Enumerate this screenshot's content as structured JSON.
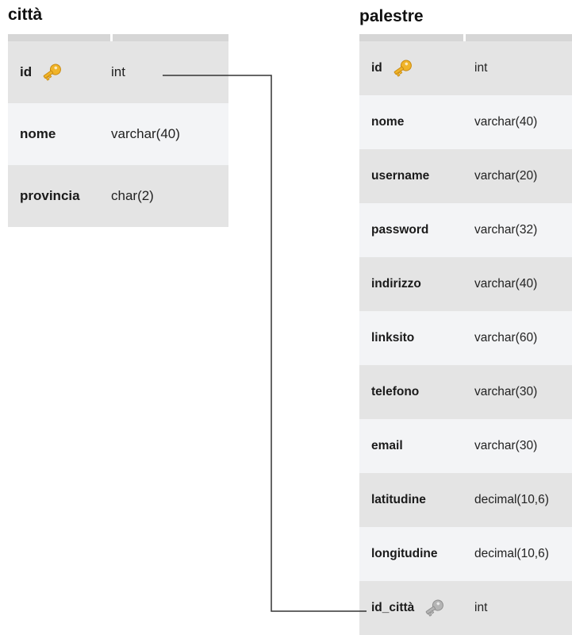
{
  "tables": [
    {
      "title": "città",
      "columns": [
        {
          "name": "id",
          "type": "int",
          "key": "primary"
        },
        {
          "name": "nome",
          "type": "varchar(40)",
          "key": ""
        },
        {
          "name": "provincia",
          "type": "char(2)",
          "key": ""
        }
      ]
    },
    {
      "title": "palestre",
      "columns": [
        {
          "name": "id",
          "type": "int",
          "key": "primary"
        },
        {
          "name": "nome",
          "type": "varchar(40)",
          "key": ""
        },
        {
          "name": "username",
          "type": "varchar(20)",
          "key": ""
        },
        {
          "name": "password",
          "type": "varchar(32)",
          "key": ""
        },
        {
          "name": "indirizzo",
          "type": "varchar(40)",
          "key": ""
        },
        {
          "name": "linksito",
          "type": "varchar(60)",
          "key": ""
        },
        {
          "name": "telefono",
          "type": "varchar(30)",
          "key": ""
        },
        {
          "name": "email",
          "type": "varchar(30)",
          "key": ""
        },
        {
          "name": "latitudine",
          "type": "decimal(10,6)",
          "key": ""
        },
        {
          "name": "longitudine",
          "type": "decimal(10,6)",
          "key": ""
        },
        {
          "name": "id_città",
          "type": "int",
          "key": "foreign"
        }
      ]
    }
  ],
  "relation": {
    "from": "città.id",
    "to": "palestre.id_città"
  },
  "icons": {
    "primary": "primary-key-icon",
    "foreign": "foreign-key-icon"
  },
  "colors": {
    "primary_key": "#f0b429",
    "foreign_key": "#b5b5b5",
    "row_dark": "#e4e4e4",
    "row_light": "#f3f4f6",
    "header": "#d6d6d6",
    "connector": "#333333"
  }
}
